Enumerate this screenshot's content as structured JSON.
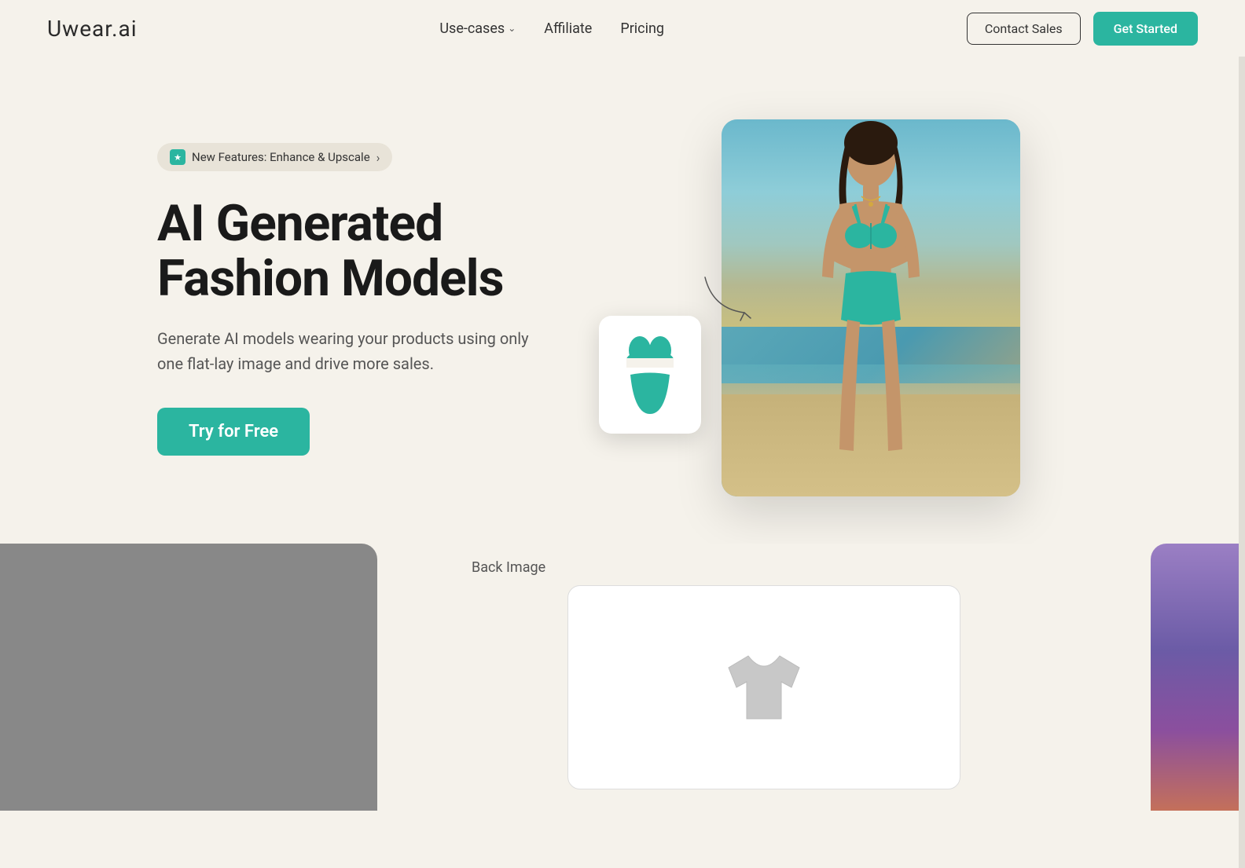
{
  "brand": {
    "name": "Uwear.ai",
    "logo_text": "Uwear.ai"
  },
  "nav": {
    "use_cases_label": "Use-cases",
    "affiliate_label": "Affiliate",
    "pricing_label": "Pricing",
    "contact_sales_label": "Contact Sales",
    "get_started_label": "Get Started"
  },
  "hero": {
    "badge_text": "New Features: Enhance & Upscale",
    "title_line1": "AI Generated",
    "title_line2": "Fashion Models",
    "subtitle": "Generate AI models wearing your products using only one flat-lay image and drive more sales.",
    "cta_label": "Try for Free"
  },
  "bottom": {
    "back_image_label": "Back Image"
  },
  "colors": {
    "teal": "#2bb5a0",
    "bg": "#f5f2eb",
    "badge_bg": "#e8e3d8"
  }
}
